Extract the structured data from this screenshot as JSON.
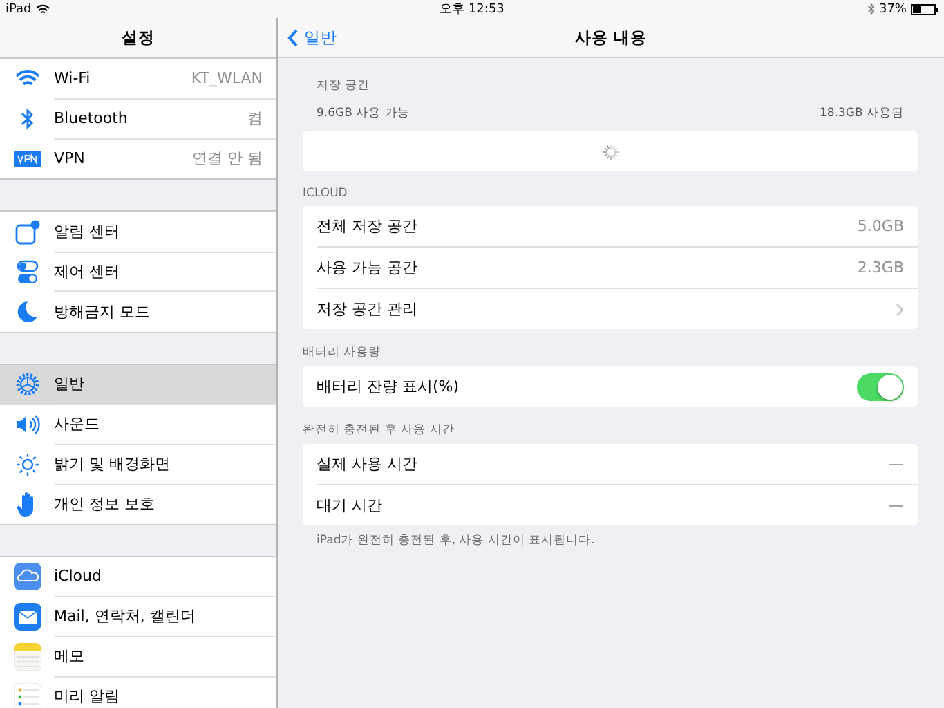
{
  "status_bar": {
    "device": "iPad",
    "time": "오후 12:53",
    "battery_percent": "37%"
  },
  "sidebar": {
    "title": "설정",
    "groups": [
      {
        "items": [
          {
            "label": "Wi-Fi",
            "value": "KT_WLAN",
            "selected": false
          },
          {
            "label": "Bluetooth",
            "value": "켬",
            "selected": false
          },
          {
            "label": "VPN",
            "value": "연결 안 됨",
            "selected": false
          }
        ]
      },
      {
        "items": [
          {
            "label": "알림 센터",
            "selected": false
          },
          {
            "label": "제어 센터",
            "selected": false
          },
          {
            "label": "방해금지 모드",
            "selected": false
          }
        ]
      },
      {
        "items": [
          {
            "label": "일반",
            "selected": true
          },
          {
            "label": "사운드",
            "selected": false
          },
          {
            "label": "밝기 및 배경화면",
            "selected": false
          },
          {
            "label": "개인 정보 보호",
            "selected": false
          }
        ]
      },
      {
        "items": [
          {
            "label": "iCloud",
            "selected": false
          },
          {
            "label": "Mail, 연락처, 캘린더",
            "selected": false
          },
          {
            "label": "메모",
            "selected": false
          },
          {
            "label": "미리 알림",
            "selected": false
          }
        ]
      }
    ]
  },
  "nav": {
    "back": "일반",
    "title": "사용 내용"
  },
  "storage": {
    "header": "저장 공간",
    "available": "9.6GB 사용 가능",
    "used": "18.3GB 사용됨"
  },
  "sections": [
    {
      "header": "ICLOUD",
      "rows": [
        {
          "kind": "value",
          "label": "전체 저장 공간",
          "value": "5.0GB"
        },
        {
          "kind": "value",
          "label": "사용 가능 공간",
          "value": "2.3GB"
        },
        {
          "kind": "link",
          "label": "저장 공간 관리"
        }
      ]
    },
    {
      "header": "배터리 사용량",
      "rows": [
        {
          "kind": "toggle",
          "label": "배터리 잔량 표시(%)",
          "on": true
        }
      ]
    },
    {
      "header": "완전히 충전된 후 사용 시간",
      "rows": [
        {
          "kind": "value",
          "label": "실제 사용 시간",
          "value": "—"
        },
        {
          "kind": "value",
          "label": "대기 시간",
          "value": "—"
        }
      ],
      "footer": "iPad가 완전히 충전된 후, 사용 시간이 표시됩니다."
    }
  ]
}
